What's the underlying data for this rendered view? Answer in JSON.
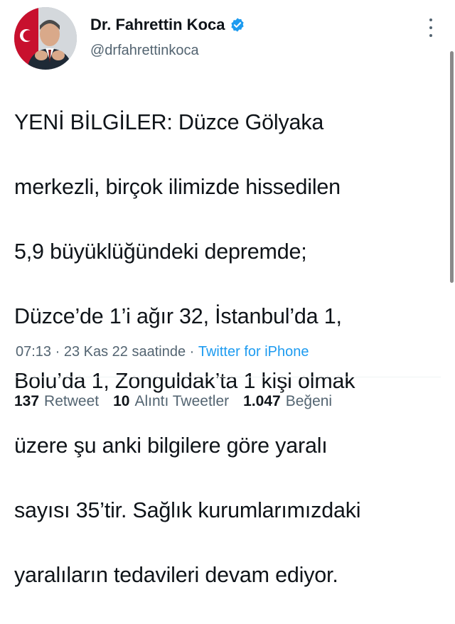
{
  "author": {
    "display_name": "Dr. Fahrettin Koca",
    "handle": "@drfahrettinkoca",
    "avatar_icon": "profile-photo",
    "verified_icon": "verified-badge-icon",
    "verified_color": "#1d9bf0"
  },
  "tweet": {
    "text_lines": [
      "YENİ BİLGİLER: Düzce Gölyaka",
      "merkezli, birçok ilimizde hissedilen",
      "5,9 büyüklüğündeki depremde;",
      "Düzce’de 1’i ağır 32, İstanbul’da 1,",
      "Bolu’da 1, Zonguldak’ta 1 kişi olmak",
      "üzere şu anki bilgilere göre yaralı",
      "sayısı 35’tir. Sağlık kurumlarımızdaki",
      "yaralıların tedavileri devam ediyor."
    ],
    "time": "07:13",
    "separator": " · ",
    "date": "23 Kas 22 saatinde",
    "source": "Twitter for iPhone"
  },
  "stats": {
    "retweets": {
      "count": "137",
      "label": "Retweet"
    },
    "quotes": {
      "count": "10",
      "label": "Alıntı Tweetler"
    },
    "likes": {
      "count": "1.047",
      "label": "Beğeni"
    }
  },
  "colors": {
    "text": "#0f1419",
    "secondary": "#536471",
    "link": "#1d9bf0"
  }
}
